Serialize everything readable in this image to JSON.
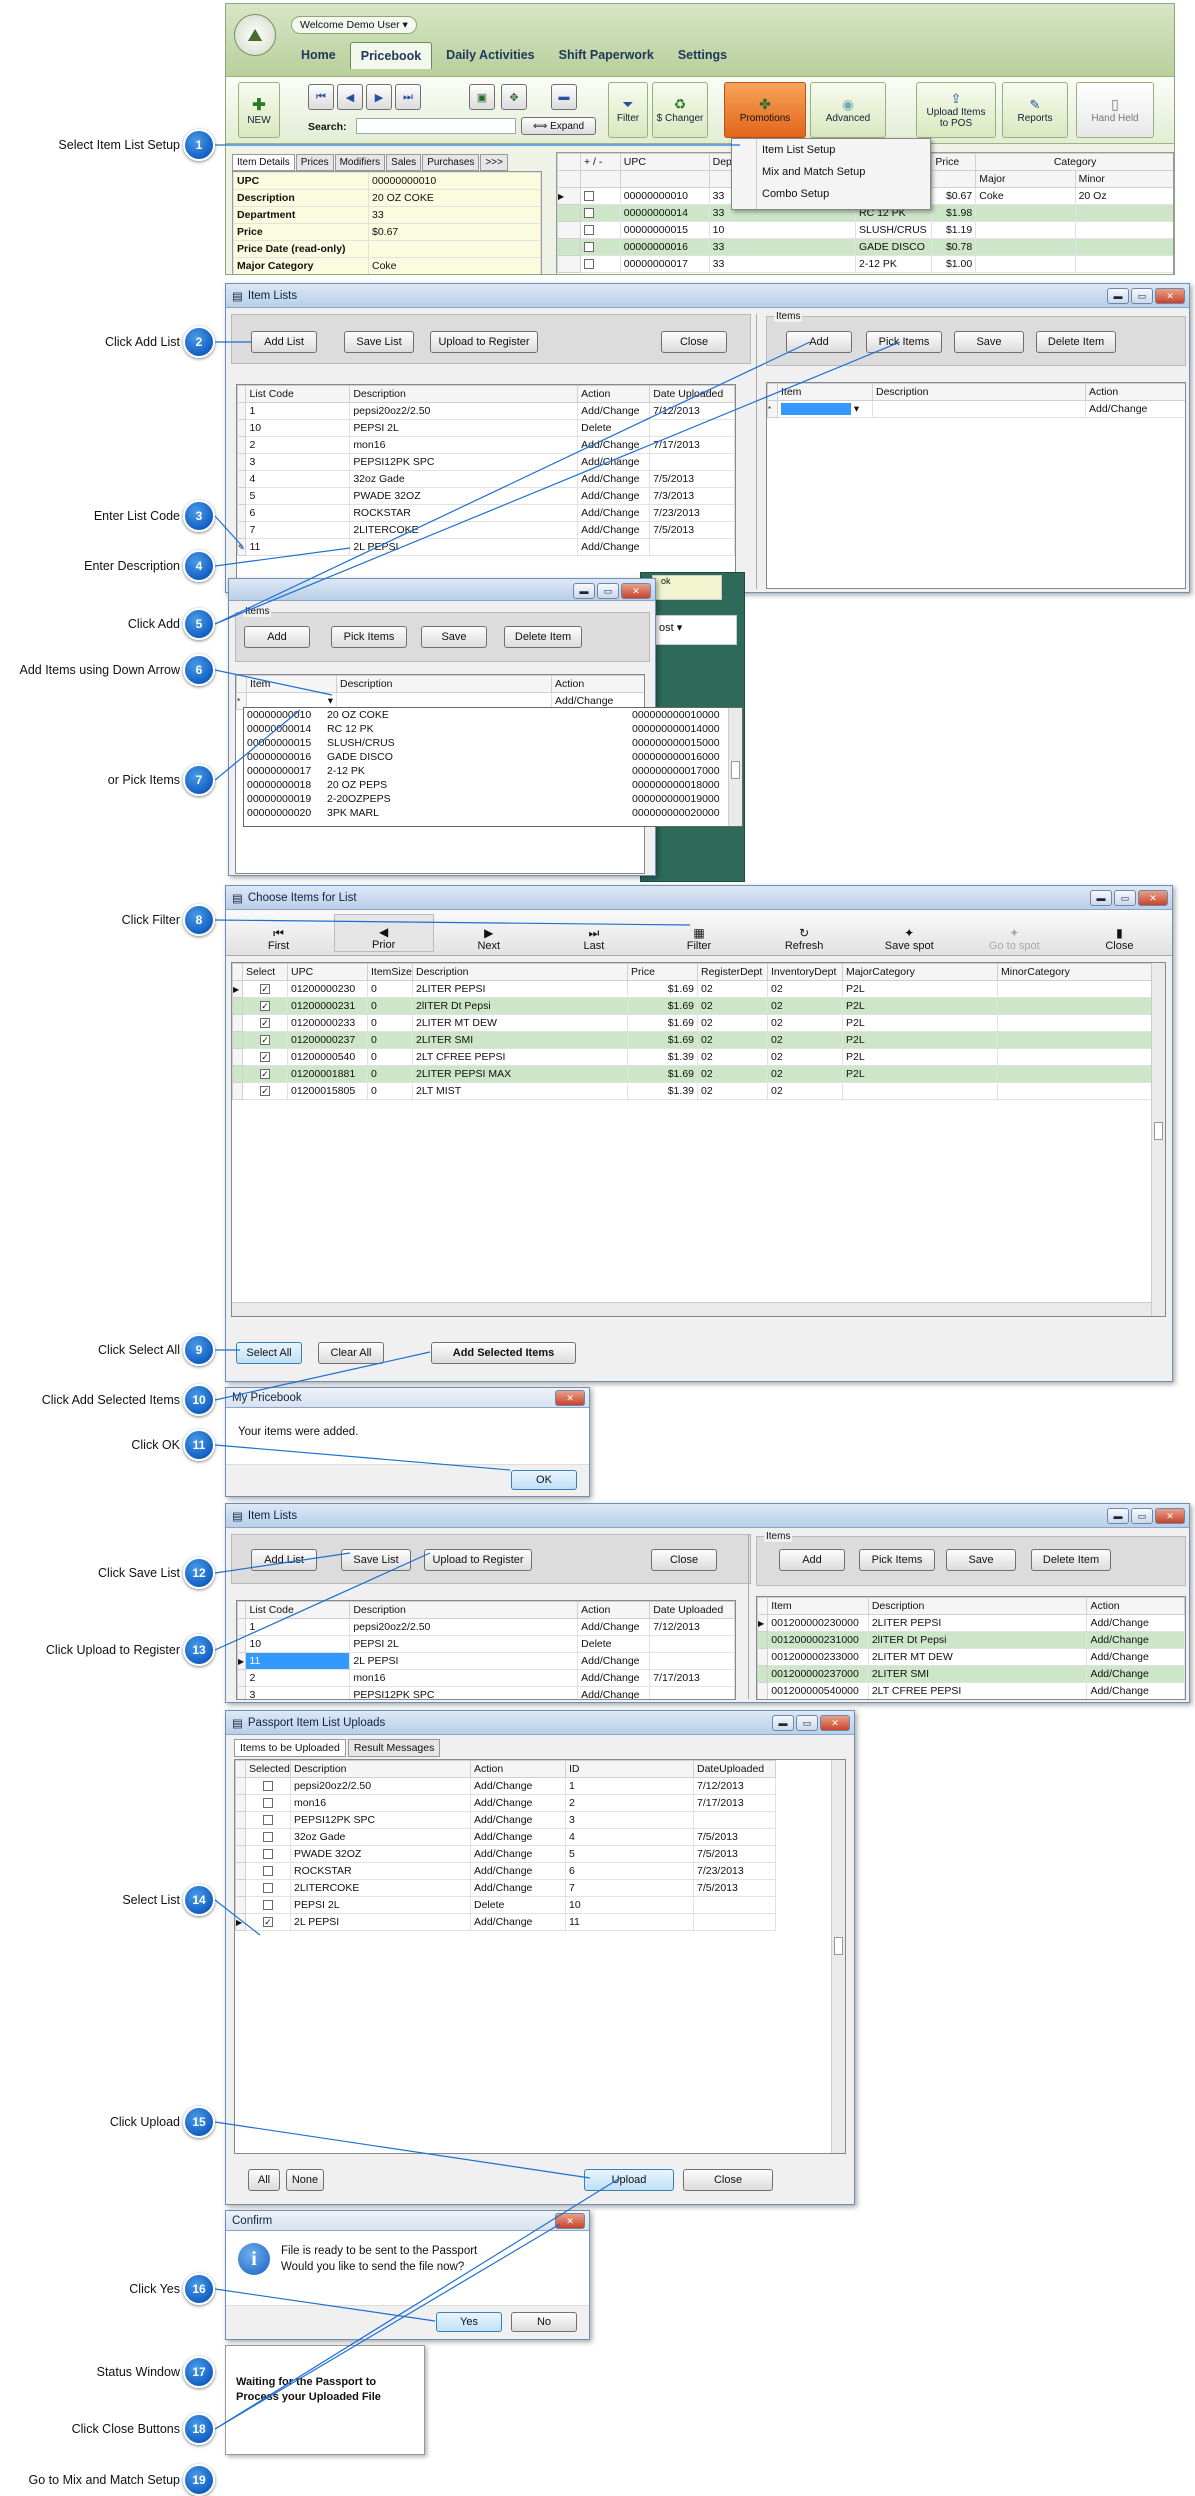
{
  "steps": [
    {
      "num": "1",
      "label": "Select Item List Setup"
    },
    {
      "num": "2",
      "label": "Click Add List"
    },
    {
      "num": "3",
      "label": "Enter List Code"
    },
    {
      "num": "4",
      "label": "Enter Description"
    },
    {
      "num": "5",
      "label": "Click Add"
    },
    {
      "num": "6",
      "label": "Add Items using Down Arrow"
    },
    {
      "num": "7",
      "label": "or Pick Items"
    },
    {
      "num": "8",
      "label": "Click Filter"
    },
    {
      "num": "9",
      "label": "Click Select All"
    },
    {
      "num": "10",
      "label": "Click Add Selected Items"
    },
    {
      "num": "11",
      "label": "Click OK"
    },
    {
      "num": "12",
      "label": "Click Save List"
    },
    {
      "num": "13",
      "label": "Click Upload to Register"
    },
    {
      "num": "14",
      "label": "Select List"
    },
    {
      "num": "15",
      "label": "Click Upload"
    },
    {
      "num": "16",
      "label": "Click Yes"
    },
    {
      "num": "17",
      "label": "Status Window"
    },
    {
      "num": "18",
      "label": "Click Close Buttons"
    },
    {
      "num": "19",
      "label": "Go to Mix and Match Setup"
    }
  ],
  "main": {
    "welcome": "Welcome Demo User ▾",
    "tabs": [
      "Home",
      "Pricebook",
      "Daily Activities",
      "Shift Paperwork",
      "Settings"
    ],
    "new_label": "NEW",
    "search_label": "Search:",
    "expand": "⟺ Expand",
    "filter": "Filter",
    "schanger": "$ Changer",
    "promotions": "Promotions",
    "advanced": "Advanced",
    "upload_pos": "Upload Items to POS",
    "reports": "Reports",
    "handheld": "Hand Held",
    "promo_menu": [
      "Item List Setup",
      "Mix and Match Setup",
      "Combo Setup"
    ],
    "detail_tabs": [
      "Item Details",
      "Prices",
      "Modifiers",
      "Sales",
      "Purchases",
      ">>>"
    ],
    "details": [
      [
        "UPC",
        "00000000010"
      ],
      [
        "Description",
        "20 OZ COKE"
      ],
      [
        "Department",
        "33"
      ],
      [
        "Price",
        "$0.67"
      ],
      [
        "Price Date (read-only)",
        ""
      ],
      [
        "Major Category",
        "Coke"
      ]
    ],
    "grid_headers": [
      "+ / -",
      "UPC",
      "Dep",
      "Price",
      "Category"
    ],
    "cat_sub": [
      "Major",
      "Minor"
    ],
    "grid_rows": [
      [
        "00000000010",
        "33",
        "",
        "$0.67",
        "Coke",
        "20 Oz"
      ],
      [
        "00000000014",
        "33",
        "RC 12 PK",
        "$1.98",
        "",
        ""
      ],
      [
        "00000000015",
        "10",
        "SLUSH/CRUS",
        "$1.19",
        "",
        ""
      ],
      [
        "00000000016",
        "33",
        "GADE DISCO",
        "$0.78",
        "",
        ""
      ],
      [
        "00000000017",
        "33",
        "2-12 PK",
        "$1.00",
        "",
        ""
      ]
    ]
  },
  "item_lists": {
    "title": "Item Lists",
    "add_list": "Add List",
    "save_list": "Save List",
    "upload_register": "Upload to Register",
    "close": "Close",
    "items_group": "Items",
    "add": "Add",
    "pick_items": "Pick Items",
    "save": "Save",
    "delete_item": "Delete Item",
    "list_headers": [
      "List Code",
      "Description",
      "Action",
      "Date Uploaded"
    ],
    "rows": [
      [
        "1",
        "pepsi20oz2/2.50",
        "Add/Change",
        "7/12/2013"
      ],
      [
        "10",
        "PEPSI 2L",
        "Delete",
        ""
      ],
      [
        "2",
        "mon16",
        "Add/Change",
        "7/17/2013"
      ],
      [
        "3",
        "PEPSI12PK SPC",
        "Add/Change",
        ""
      ],
      [
        "4",
        "32oz Gade",
        "Add/Change",
        "7/5/2013"
      ],
      [
        "5",
        "PWADE 32OZ",
        "Add/Change",
        "7/3/2013"
      ],
      [
        "6",
        "ROCKSTAR",
        "Add/Change",
        "7/23/2013"
      ],
      [
        "7",
        "2LITERCOKE",
        "Add/Change",
        "7/5/2013"
      ],
      [
        "11",
        "2L PEPSI",
        "Add/Change",
        ""
      ]
    ],
    "item_headers": [
      "Item",
      "Description",
      "Action"
    ],
    "new_item_action": "Add/Change"
  },
  "items_popup": {
    "group": "Items",
    "add": "Add",
    "pick": "Pick Items",
    "save": "Save",
    "delete": "Delete Item",
    "headers": [
      "Item",
      "Description",
      "Action"
    ],
    "new_action": "Add/Change",
    "dropdown": [
      [
        "00000000010",
        "20 OZ COKE",
        "000000000010000"
      ],
      [
        "00000000014",
        "RC 12 PK",
        "000000000014000"
      ],
      [
        "00000000015",
        "SLUSH/CRUS",
        "000000000015000"
      ],
      [
        "00000000016",
        "GADE DISCO",
        "000000000016000"
      ],
      [
        "00000000017",
        "2-12 PK",
        "000000000017000"
      ],
      [
        "00000000018",
        "20 OZ PEPS",
        "000000000018000"
      ],
      [
        "00000000019",
        "2-20OZPEPS",
        "000000000019000"
      ],
      [
        "00000000020",
        "3PK MARL",
        "000000000020000"
      ]
    ],
    "ok_fragment": "ok",
    "cost_fragment": "ost"
  },
  "choose": {
    "title": "Choose Items for List",
    "nav": [
      "First",
      "Prior",
      "Next",
      "Last",
      "Filter",
      "Refresh",
      "Save spot",
      "Go to spot",
      "Close"
    ],
    "headers": [
      "Select",
      "UPC",
      "ItemSize",
      "Description",
      "Price",
      "RegisterDept",
      "InventoryDept",
      "MajorCategory",
      "MinorCategory"
    ],
    "rows": [
      [
        "01200000230",
        "0",
        "2LITER PEPSI",
        "$1.69",
        "02",
        "02",
        "P2L"
      ],
      [
        "01200000231",
        "0",
        "2lITER Dt Pepsi",
        "$1.69",
        "02",
        "02",
        "P2L"
      ],
      [
        "01200000233",
        "0",
        "2LITER MT DEW",
        "$1.69",
        "02",
        "02",
        "P2L"
      ],
      [
        "01200000237",
        "0",
        "2LITER SMI",
        "$1.69",
        "02",
        "02",
        "P2L"
      ],
      [
        "01200000540",
        "0",
        "2LT CFREE PEPSI",
        "$1.39",
        "02",
        "02",
        "P2L"
      ],
      [
        "01200001881",
        "0",
        "2LITER PEPSI MAX",
        "$1.69",
        "02",
        "02",
        "P2L"
      ],
      [
        "01200015805",
        "0",
        "2LT MIST",
        "$1.39",
        "02",
        "02",
        ""
      ]
    ],
    "select_all": "Select All",
    "clear_all": "Clear All",
    "add_selected": "Add Selected Items"
  },
  "msg": {
    "title": "My Pricebook",
    "text": "Your items were added.",
    "ok": "OK"
  },
  "item_lists2": {
    "title": "Item Lists",
    "add_list": "Add List",
    "save_list": "Save List",
    "upload_register": "Upload to Register",
    "close": "Close",
    "items_group": "Items",
    "add": "Add",
    "pick_items": "Pick Items",
    "save": "Save",
    "delete_item": "Delete Item",
    "list_headers": [
      "List Code",
      "Description",
      "Action",
      "Date Uploaded"
    ],
    "rows": [
      [
        "1",
        "pepsi20oz2/2.50",
        "Add/Change",
        "7/12/2013"
      ],
      [
        "10",
        "PEPSI 2L",
        "Delete",
        ""
      ],
      [
        "11",
        "2L PEPSI",
        "Add/Change",
        ""
      ],
      [
        "2",
        "mon16",
        "Add/Change",
        "7/17/2013"
      ],
      [
        "3",
        "PEPSI12PK SPC",
        "Add/Change",
        ""
      ]
    ],
    "item_headers": [
      "Item",
      "Description",
      "Action"
    ],
    "items": [
      [
        "001200000230000",
        "2LITER PEPSI",
        "Add/Change"
      ],
      [
        "001200000231000",
        "2lITER Dt Pepsi",
        "Add/Change"
      ],
      [
        "001200000233000",
        "2LITER MT DEW",
        "Add/Change"
      ],
      [
        "001200000237000",
        "2LITER SMI",
        "Add/Change"
      ],
      [
        "001200000540000",
        "2LT CFREE PEPSI",
        "Add/Change"
      ]
    ]
  },
  "passport": {
    "title": "Passport Item List Uploads",
    "tabs": [
      "Items to be Uploaded",
      "Result Messages"
    ],
    "headers": [
      "Selected",
      "Description",
      "Action",
      "ID",
      "DateUploaded"
    ],
    "rows": [
      [
        "pepsi20oz2/2.50",
        "Add/Change",
        "1",
        "7/12/2013"
      ],
      [
        "mon16",
        "Add/Change",
        "2",
        "7/17/2013"
      ],
      [
        "PEPSI12PK SPC",
        "Add/Change",
        "3",
        ""
      ],
      [
        "32oz Gade",
        "Add/Change",
        "4",
        "7/5/2013"
      ],
      [
        "PWADE 32OZ",
        "Add/Change",
        "5",
        "7/5/2013"
      ],
      [
        "ROCKSTAR",
        "Add/Change",
        "6",
        "7/23/2013"
      ],
      [
        "2LITERCOKE",
        "Add/Change",
        "7",
        "7/5/2013"
      ],
      [
        "PEPSI 2L",
        "Delete",
        "10",
        ""
      ],
      [
        "2L PEPSI",
        "Add/Change",
        "11",
        ""
      ]
    ],
    "all": "All",
    "none": "None",
    "upload": "Upload",
    "close": "Close"
  },
  "confirm": {
    "title": "Confirm",
    "line1": "File is ready to be sent to the Passport",
    "line2": "Would you like to send the file now?",
    "yes": "Yes",
    "no": "No"
  },
  "status": {
    "line1": "Waiting for the Passport to",
    "line2": "Process your Uploaded File"
  }
}
